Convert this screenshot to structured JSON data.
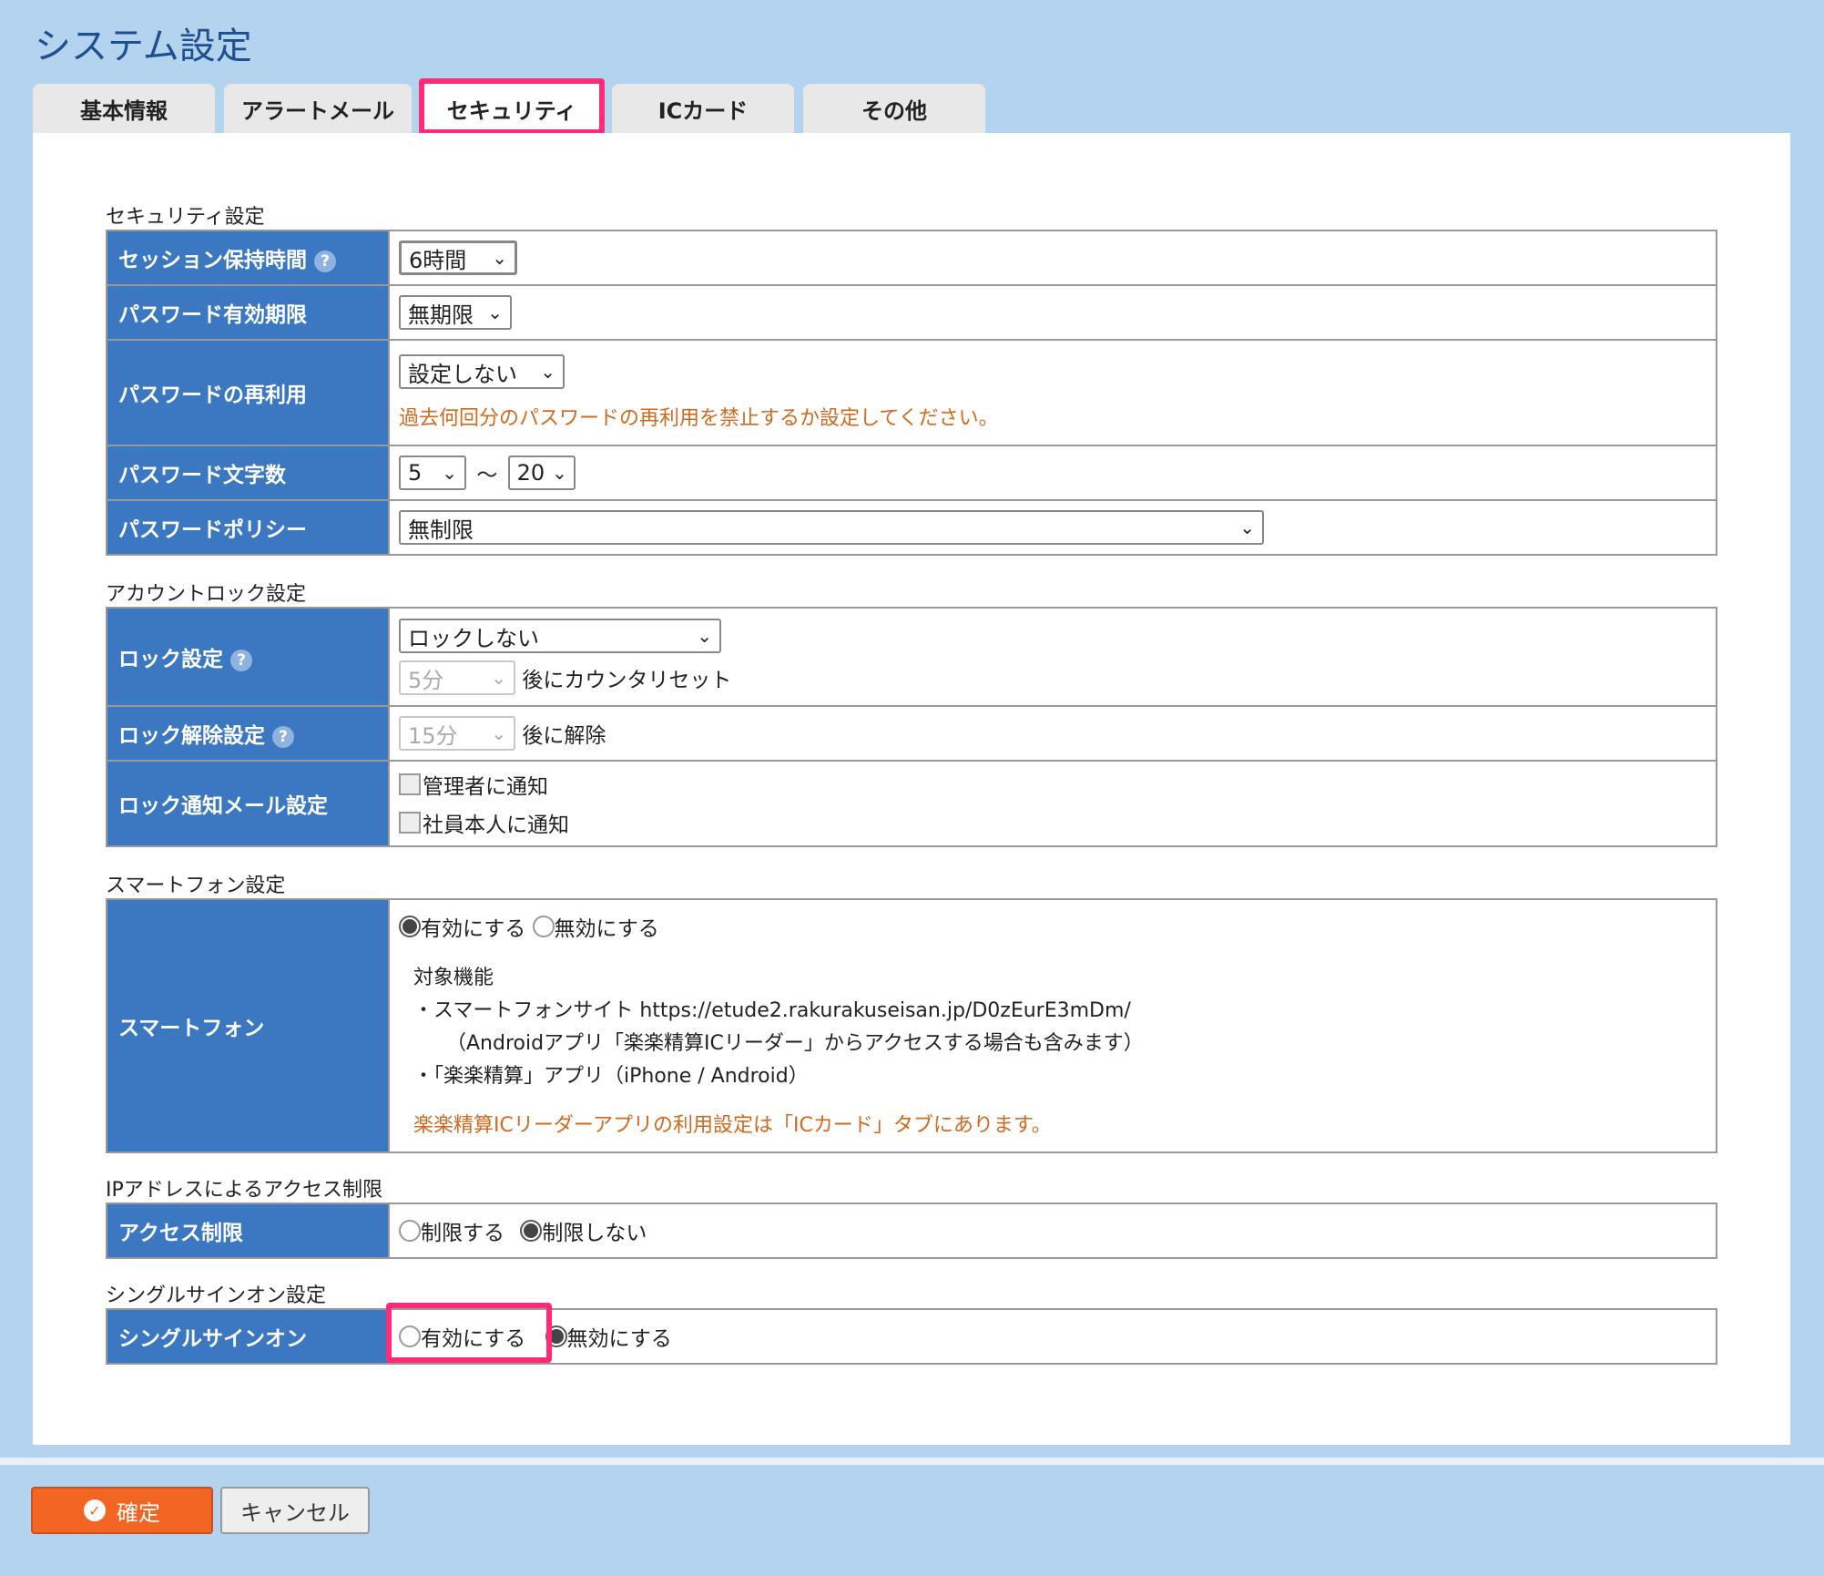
{
  "page_title": "システム設定",
  "tabs": [
    {
      "label": "基本情報"
    },
    {
      "label": "アラートメール"
    },
    {
      "label": "セキュリティ"
    },
    {
      "label": "ICカード"
    },
    {
      "label": "その他"
    }
  ],
  "security": {
    "title": "セキュリティ設定",
    "session": {
      "label": "セッション保持時間",
      "value": "6時間"
    },
    "pw_expiry": {
      "label": "パスワード有効期限",
      "value": "無期限"
    },
    "pw_reuse": {
      "label": "パスワードの再利用",
      "value": "設定しない",
      "note": "過去何回分のパスワードの再利用を禁止するか設定してください。"
    },
    "pw_length": {
      "label": "パスワード文字数",
      "min": "5",
      "max": "20",
      "sep": "〜"
    },
    "pw_policy": {
      "label": "パスワードポリシー",
      "value": "無制限"
    }
  },
  "lock": {
    "title": "アカウントロック設定",
    "lock_setting": {
      "label": "ロック設定",
      "value": "ロックしない",
      "reset_value": "5分",
      "reset_text": "後にカウンタリセット"
    },
    "unlock": {
      "label": "ロック解除設定",
      "value": "15分",
      "text": "後に解除"
    },
    "mail": {
      "label": "ロック通知メール設定",
      "opt1": "管理者に通知",
      "opt2": "社員本人に通知"
    }
  },
  "smartphone": {
    "title": "スマートフォン設定",
    "label": "スマートフォン",
    "enable": "有効にする",
    "disable": "無効にする",
    "target_title": "対象機能",
    "line1": "・スマートフォンサイト https://etude2.rakurakuseisan.jp/D0zEurE3mDm/",
    "line2": "（Androidアプリ「楽楽精算ICリーダー」からアクセスする場合も含みます）",
    "line3": "・「楽楽精算」アプリ（iPhone / Android）",
    "note": "楽楽精算ICリーダーアプリの利用設定は「ICカード」タブにあります。"
  },
  "ip": {
    "title": "IPアドレスによるアクセス制限",
    "label": "アクセス制限",
    "restrict": "制限する",
    "no_restrict": "制限しない"
  },
  "sso": {
    "title": "シングルサインオン設定",
    "label": "シングルサインオン",
    "enable": "有効にする",
    "disable": "無効にする"
  },
  "buttons": {
    "ok": "確定",
    "cancel": "キャンセル"
  },
  "colors": {
    "label_bg": "#3b78c1",
    "highlight": "#ff2a7a",
    "ok_button": "#f26522",
    "note": "#d2691e",
    "background": "#b3d3ee"
  }
}
